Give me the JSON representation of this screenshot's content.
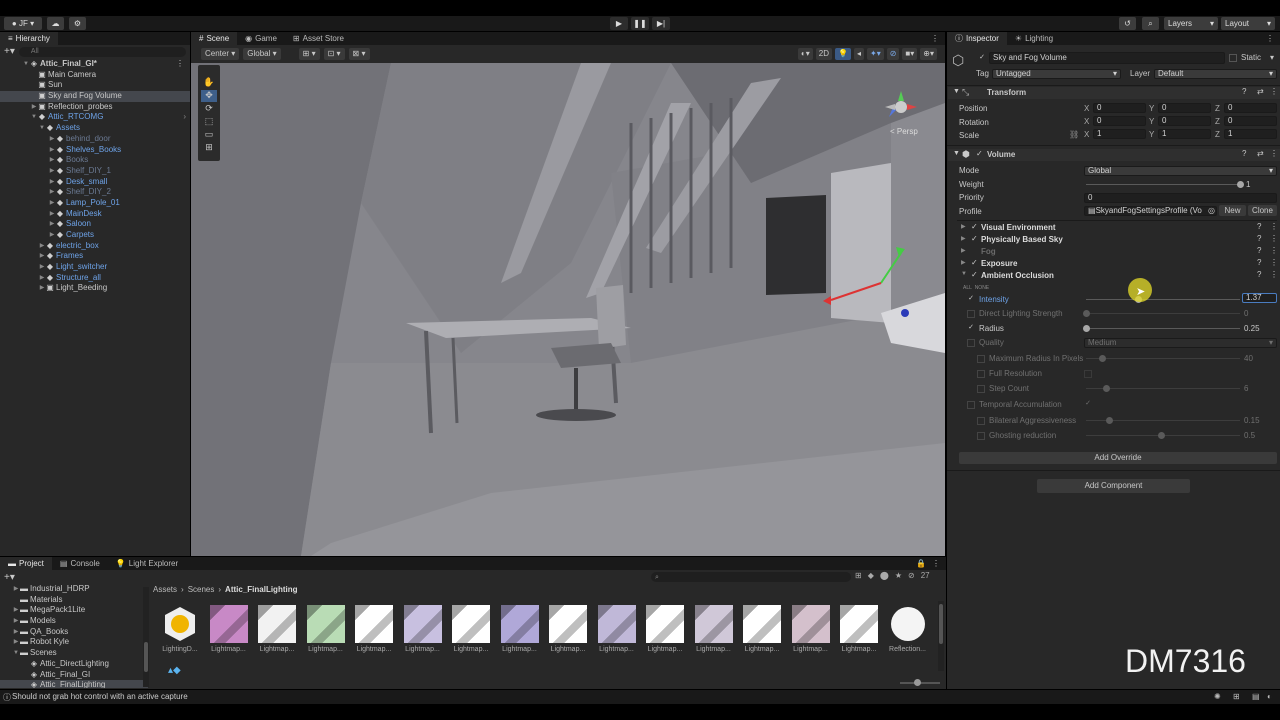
{
  "toolbar": {
    "account": "JF",
    "layers": "Layers",
    "layout": "Layout"
  },
  "scene_tabs": [
    "Scene",
    "Game",
    "Asset Store"
  ],
  "scene_toolbar": {
    "pivot": "Center",
    "space": "Global",
    "mode2d": "2D",
    "persp": "< Persp"
  },
  "hierarchy": {
    "title": "Hierarchy",
    "search_placeholder": "All",
    "items": [
      {
        "label": "Attic_Final_GI*"
      },
      {
        "label": "Main Camera"
      },
      {
        "label": "Sun"
      },
      {
        "label": "Sky and Fog Volume"
      },
      {
        "label": "Reflection_probes"
      },
      {
        "label": "Attic_RTCOMG"
      },
      {
        "label": "Assets"
      },
      {
        "label": "behind_door"
      },
      {
        "label": "Shelves_Books"
      },
      {
        "label": "Books"
      },
      {
        "label": "Shelf_DIY_1"
      },
      {
        "label": "Desk_small"
      },
      {
        "label": "Shelf_DIY_2"
      },
      {
        "label": "Lamp_Pole_01"
      },
      {
        "label": "MainDesk"
      },
      {
        "label": "Saloon"
      },
      {
        "label": "Carpets"
      },
      {
        "label": "electric_box"
      },
      {
        "label": "Frames"
      },
      {
        "label": "Light_switcher"
      },
      {
        "label": "Structure_all"
      },
      {
        "label": "Light_Beeding"
      }
    ]
  },
  "inspector": {
    "tabs": [
      "Inspector",
      "Lighting"
    ],
    "object_name": "Sky and Fog Volume",
    "static_label": "Static",
    "tag_label": "Tag",
    "tag_value": "Untagged",
    "layer_label": "Layer",
    "layer_value": "Default",
    "transform": {
      "title": "Transform",
      "position": {
        "label": "Position",
        "x": "0",
        "y": "0",
        "z": "0"
      },
      "rotation": {
        "label": "Rotation",
        "x": "0",
        "y": "0",
        "z": "0"
      },
      "scale": {
        "label": "Scale",
        "x": "1",
        "y": "1",
        "z": "1"
      }
    },
    "volume": {
      "title": "Volume",
      "mode_label": "Mode",
      "mode_value": "Global",
      "weight_label": "Weight",
      "weight_value": "1",
      "weight_fraction": 1,
      "priority_label": "Priority",
      "priority_value": "0",
      "profile_label": "Profile",
      "profile_value": "SkyandFogSettingsProfile (Vo",
      "new_label": "New",
      "clone_label": "Clone"
    },
    "overrides": [
      {
        "label": "Visual Environment",
        "enabled": true
      },
      {
        "label": "Physically Based Sky",
        "enabled": true
      },
      {
        "label": "Fog",
        "enabled": false
      },
      {
        "label": "Exposure",
        "enabled": true
      },
      {
        "label": "Ambient Occlusion",
        "enabled": true
      }
    ],
    "all_none": {
      "all": "ALL",
      "none": "NONE"
    },
    "ao": {
      "intensity_label": "Intensity",
      "intensity_value": "1.37",
      "direct_label": "Direct Lighting Strength",
      "direct_value": "0",
      "radius_label": "Radius",
      "radius_value": "0.25",
      "quality_label": "Quality",
      "quality_value": "Medium",
      "max_radius_label": "Maximum Radius In Pixels",
      "max_radius_value": "40",
      "full_res_label": "Full Resolution",
      "step_label": "Step Count",
      "step_value": "6",
      "temporal_label": "Temporal Accumulation",
      "bilateral_label": "Bilateral Aggressiveness",
      "bilateral_value": "0.15",
      "ghost_label": "Ghosting reduction",
      "ghost_value": "0.5"
    },
    "add_override": "Add Override",
    "add_component": "Add Component"
  },
  "project": {
    "tabs": [
      "Project",
      "Console",
      "Light Explorer"
    ],
    "folders": [
      {
        "label": "Industrial_HDRP"
      },
      {
        "label": "Materials"
      },
      {
        "label": "MegaPack1Lite"
      },
      {
        "label": "Models"
      },
      {
        "label": "QA_Books"
      },
      {
        "label": "Robot Kyle"
      },
      {
        "label": "Scenes"
      },
      {
        "label": "Attic_DirectLighting"
      },
      {
        "label": "Attic_Final_GI"
      },
      {
        "label": "Attic_FinalLighting"
      }
    ],
    "breadcrumb": [
      "Assets",
      "Scenes",
      "Attic_FinalLighting"
    ],
    "count": "27",
    "thumbs": [
      "LightingD...",
      "Lightmap...",
      "Lightmap...",
      "Lightmap...",
      "Lightmap...",
      "Lightmap...",
      "Lightmap...",
      "Lightmap...",
      "Lightmap...",
      "Lightmap...",
      "Lightmap...",
      "Lightmap...",
      "Lightmap...",
      "Lightmap...",
      "Lightmap...",
      "Reflection..."
    ]
  },
  "status": {
    "message": "Should not grab hot control with an active capture"
  },
  "watermark": "DM7316"
}
